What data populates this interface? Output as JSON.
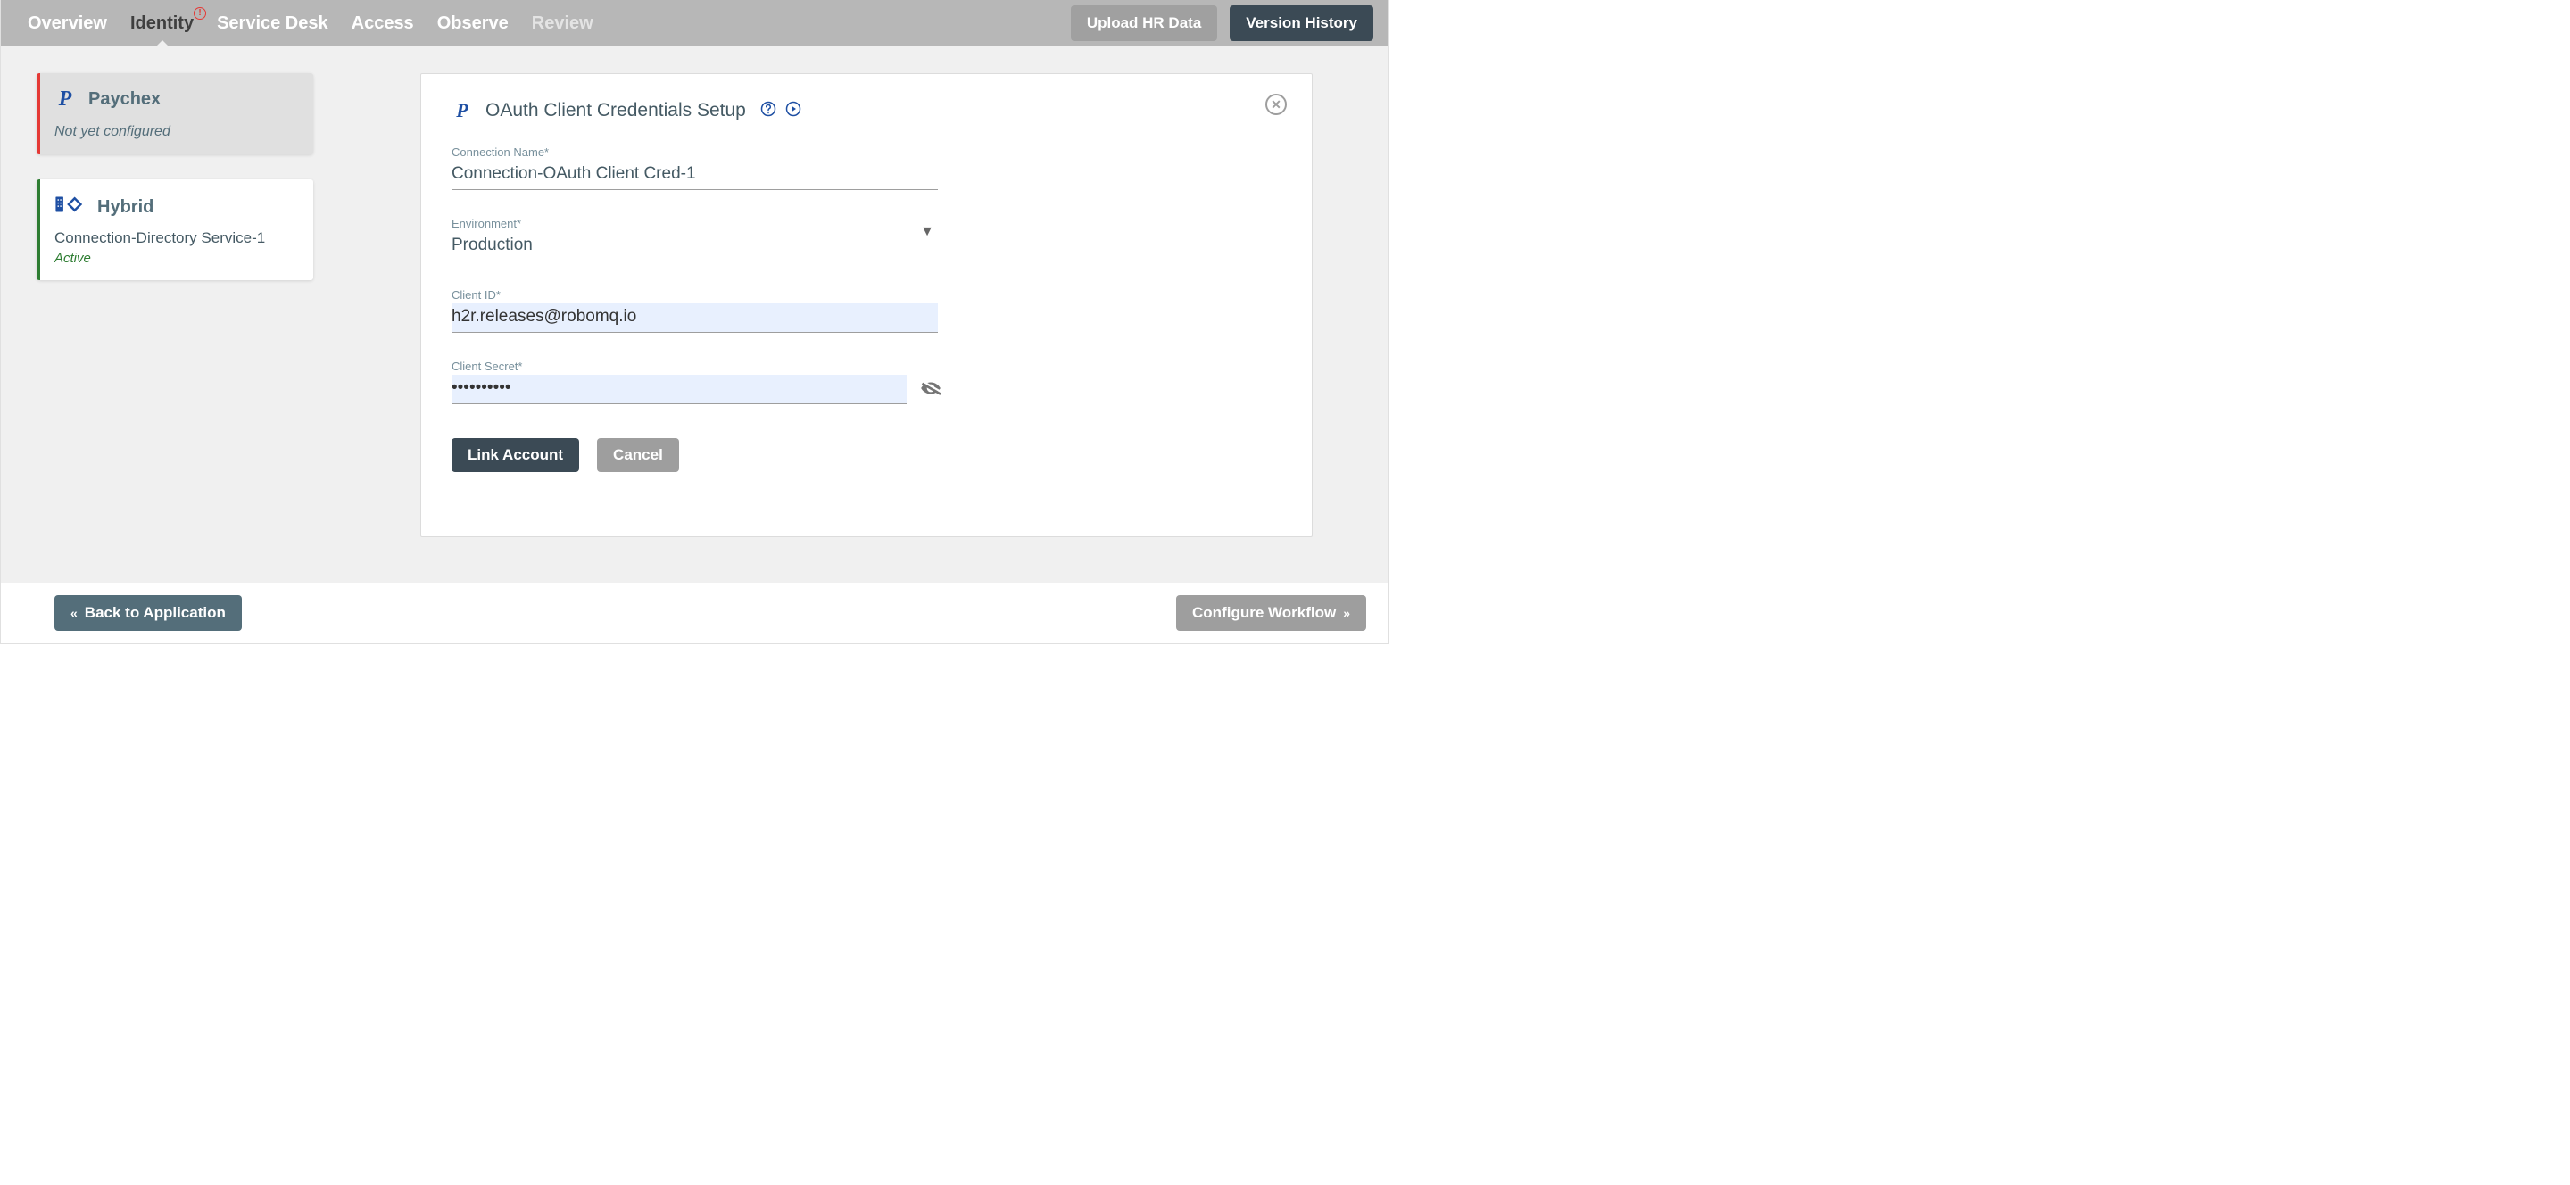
{
  "nav": {
    "tabs": [
      {
        "label": "Overview"
      },
      {
        "label": "Identity",
        "active": true,
        "alert": true
      },
      {
        "label": "Service Desk"
      },
      {
        "label": "Access"
      },
      {
        "label": "Observe"
      },
      {
        "label": "Review",
        "disabled": true
      }
    ],
    "upload_label": "Upload HR Data",
    "version_label": "Version History"
  },
  "sidebar": {
    "paychex": {
      "title": "Paychex",
      "status": "Not yet configured"
    },
    "hybrid": {
      "title": "Hybrid",
      "connection": "Connection-Directory Service-1",
      "status": "Active"
    }
  },
  "panel": {
    "title": "OAuth Client Credentials Setup",
    "fields": {
      "connection_name": {
        "label": "Connection Name*",
        "value": "Connection-OAuth Client Cred-1"
      },
      "environment": {
        "label": "Environment*",
        "value": "Production"
      },
      "client_id": {
        "label": "Client ID*",
        "value": "h2r.releases@robomq.io"
      },
      "client_secret": {
        "label": "Client Secret*",
        "value": "••••••••••"
      }
    },
    "link_label": "Link Account",
    "cancel_label": "Cancel"
  },
  "footer": {
    "back_label": "Back to Application",
    "configure_label": "Configure Workflow"
  }
}
